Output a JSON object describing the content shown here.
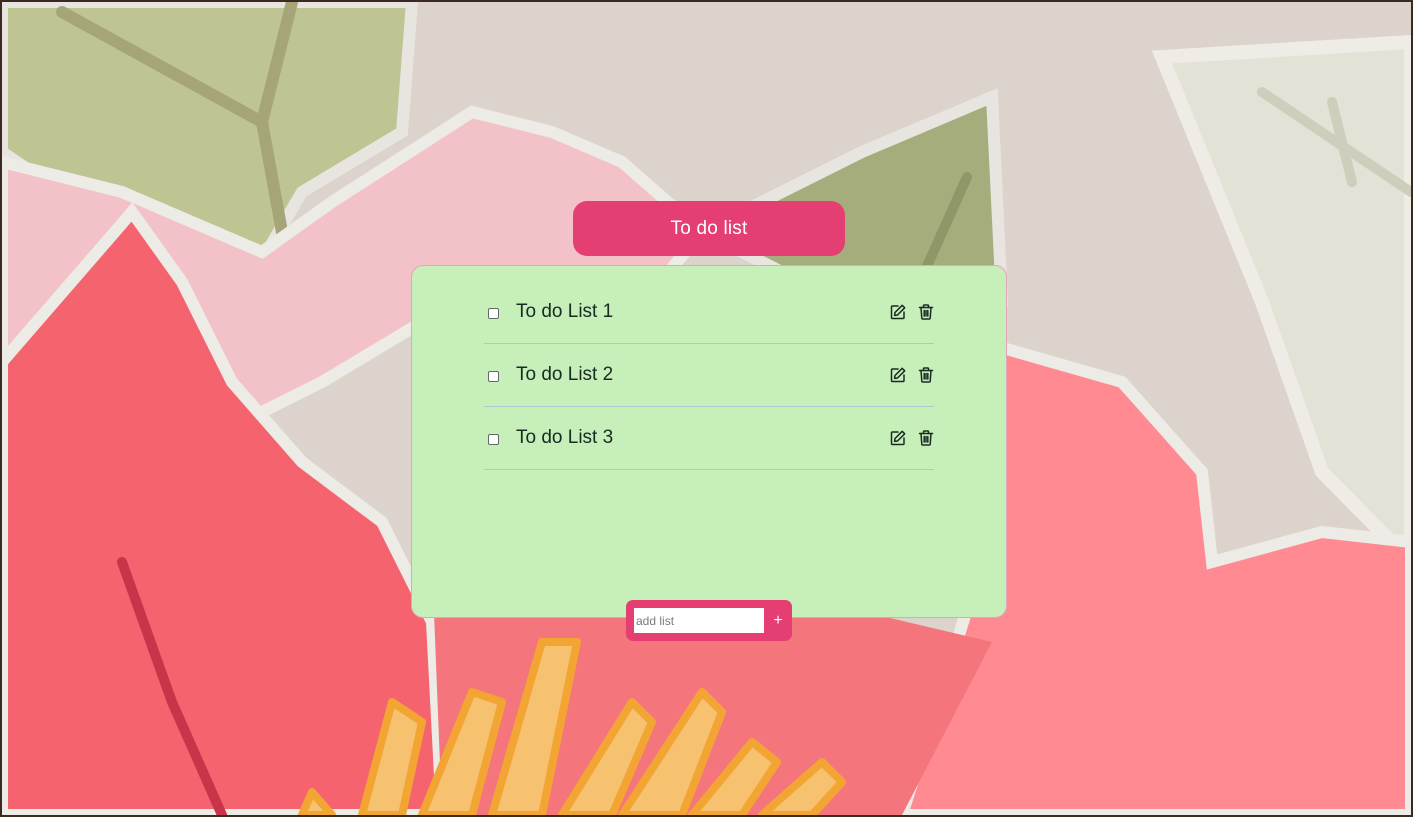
{
  "header": {
    "title": "To do list"
  },
  "todos": [
    {
      "label": "To do List 1",
      "checked": false
    },
    {
      "label": "To do List 2",
      "checked": false
    },
    {
      "label": "To do List 3",
      "checked": false
    }
  ],
  "add": {
    "placeholder": "add list",
    "button_label": "+"
  },
  "icons": {
    "edit": "edit-icon",
    "delete": "trash-icon"
  },
  "colors": {
    "accent": "#e43e72",
    "card_background": "#c6efba",
    "divider": "#a9c9cf",
    "text": "#1a2b22"
  }
}
